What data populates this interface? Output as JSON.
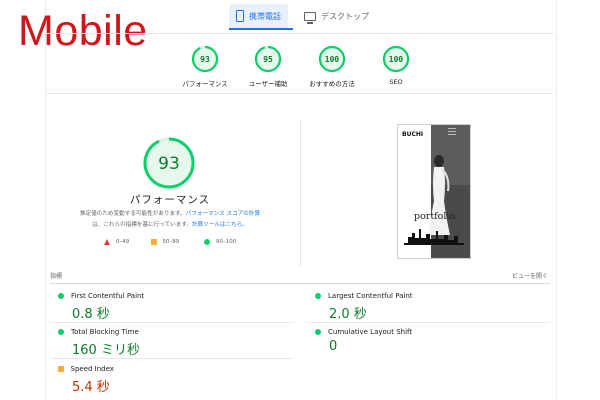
{
  "overlay_label": "Mobile",
  "tabs": [
    {
      "label": "携帯電話",
      "icon": "phone-icon",
      "active": true
    },
    {
      "label": "デスクトップ",
      "icon": "monitor-icon",
      "active": false
    }
  ],
  "scores": [
    {
      "value": "93",
      "label": "パフォーマンス",
      "fraction": 0.93
    },
    {
      "value": "95",
      "label": "ユーザー補助",
      "fraction": 0.95
    },
    {
      "value": "100",
      "label": "おすすめの方法",
      "fraction": 1.0
    },
    {
      "value": "100",
      "label": "SEO",
      "fraction": 1.0
    }
  ],
  "performance": {
    "value": "93",
    "fraction": 0.93,
    "label": "パフォーマンス",
    "desc_line1_a": "推定値のため変動する可能性があります。",
    "desc_line1_link": "パフォーマンス スコアの計算",
    "desc_line2_a": "は、これらの指標を基に行っています。",
    "desc_line2_link": "計算ツールはこちら。"
  },
  "legend": [
    {
      "shape": "triangle",
      "range": "0–49",
      "color": "#e53935"
    },
    {
      "shape": "square",
      "range": "50–89",
      "color": "#fbac32"
    },
    {
      "shape": "circle",
      "range": "90–100",
      "color": "#0cce6b"
    }
  ],
  "screenshot": {
    "brand": "BUCHI",
    "text": "portfolio"
  },
  "section": {
    "title": "指標",
    "expand_link": "ビューを開く"
  },
  "metrics": [
    {
      "name": "First Contentful Paint",
      "value": "0.8 秒",
      "status": "good"
    },
    {
      "name": "Largest Contentful Paint",
      "value": "2.0 秒",
      "status": "good"
    },
    {
      "name": "Total Blocking Time",
      "value": "160 ミリ秒",
      "status": "good"
    },
    {
      "name": "Cumulative Layout Shift",
      "value": "0",
      "status": "good"
    },
    {
      "name": "Speed Index",
      "value": "5.4 秒",
      "status": "average"
    }
  ],
  "colors": {
    "pass": "#0cce6b",
    "pass_text": "#0c7d2c",
    "average": "#fbac32",
    "average_text": "#c33300",
    "fail": "#e53935",
    "accent": "#1a73e8",
    "overlay_red": "#d3141a"
  }
}
